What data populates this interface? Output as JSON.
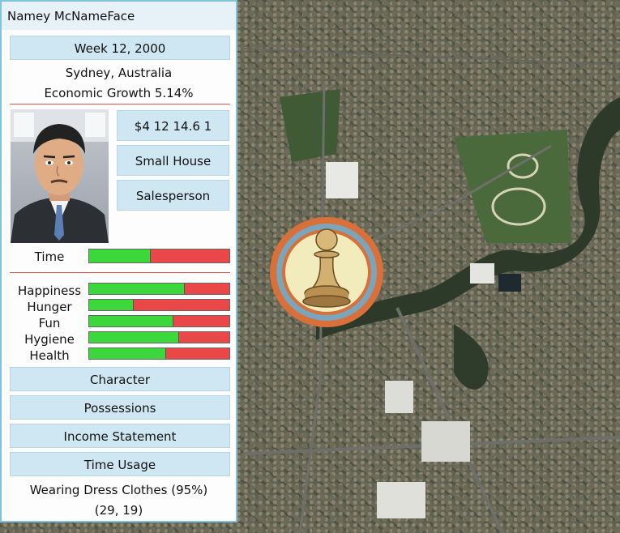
{
  "player": {
    "name": "Namey McNameFace",
    "week": "Week 12, 2000",
    "location": "Sydney, Australia",
    "growth": "Economic Growth 5.14%",
    "money": "$4 12 14.6 1",
    "home": "Small House",
    "job": "Salesperson"
  },
  "time": {
    "label": "Time",
    "level": 0.44
  },
  "stats": [
    {
      "label": "Happiness",
      "level": 0.68
    },
    {
      "label": "Hunger",
      "level": 0.32
    },
    {
      "label": "Fun",
      "level": 0.6
    },
    {
      "label": "Hygiene",
      "level": 0.64
    },
    {
      "label": "Health",
      "level": 0.55
    }
  ],
  "menu": {
    "character": "Character",
    "possessions": "Possessions",
    "income": "Income Statement",
    "time_usage": "Time Usage"
  },
  "status": {
    "clothes": "Wearing Dress Clothes (95%)",
    "coords": "(29, 19)"
  },
  "colors": {
    "bar_full": "#3bd73b",
    "bar_empty": "#ea4848",
    "accent": "#7fc3dc"
  },
  "icons": {
    "player_marker": "pawn-icon"
  }
}
